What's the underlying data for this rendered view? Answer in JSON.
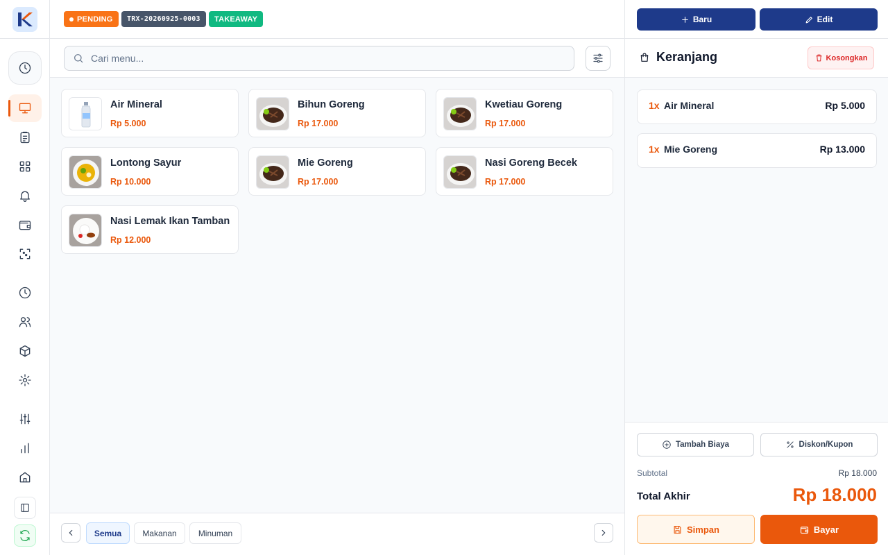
{
  "status": {
    "badge": "PENDING",
    "transaction_id": "TRX-20260925-0003",
    "order_type": "TAKEAWAY"
  },
  "search": {
    "placeholder": "Cari menu..."
  },
  "menu": [
    {
      "name": "Air Mineral",
      "price": "Rp 5.000",
      "image": "water-bottle"
    },
    {
      "name": "Bihun Goreng",
      "price": "Rp 17.000",
      "image": "fried-noodle"
    },
    {
      "name": "Kwetiau Goreng",
      "price": "Rp 17.000",
      "image": "fried-noodle"
    },
    {
      "name": "Lontong Sayur",
      "price": "Rp 10.000",
      "image": "lontong-plate"
    },
    {
      "name": "Mie Goreng",
      "price": "Rp 17.000",
      "image": "fried-noodle"
    },
    {
      "name": "Nasi Goreng Becek",
      "price": "Rp 17.000",
      "image": "fried-noodle"
    },
    {
      "name": "Nasi Lemak Ikan Tamban",
      "price": "Rp 12.000",
      "image": "nasi-lemak-plate"
    }
  ],
  "categories": [
    {
      "label": "Semua",
      "active": true
    },
    {
      "label": "Makanan",
      "active": false
    },
    {
      "label": "Minuman",
      "active": false
    }
  ],
  "panel": {
    "new_label": "Baru",
    "edit_label": "Edit",
    "cart_title": "Keranjang",
    "empty_label": "Kosongkan",
    "items": [
      {
        "qty": "1x",
        "name": "Air Mineral",
        "price": "Rp 5.000"
      },
      {
        "qty": "1x",
        "name": "Mie Goreng",
        "price": "Rp 13.000"
      }
    ],
    "add_fee_label": "Tambah Biaya",
    "discount_label": "Diskon/Kupon",
    "subtotal_label": "Subtotal",
    "subtotal_value": "Rp 18.000",
    "total_label": "Total Akhir",
    "total_value": "Rp 18.000",
    "save_label": "Simpan",
    "pay_label": "Bayar"
  },
  "colors": {
    "accent": "#ea580c",
    "primary": "#1e3a8a",
    "pending": "#f97316",
    "takeaway": "#10b981"
  },
  "sidebar_icons": [
    "clock-icon",
    "monitor-icon",
    "clipboard-icon",
    "grid-icon",
    "bell-icon",
    "wallet-icon",
    "qr-scan-icon",
    "history-icon",
    "users-icon",
    "box-icon",
    "gear-icon",
    "sliders-icon",
    "chart-icon",
    "home-icon",
    "sidebar-toggle-icon",
    "sync-icon"
  ]
}
